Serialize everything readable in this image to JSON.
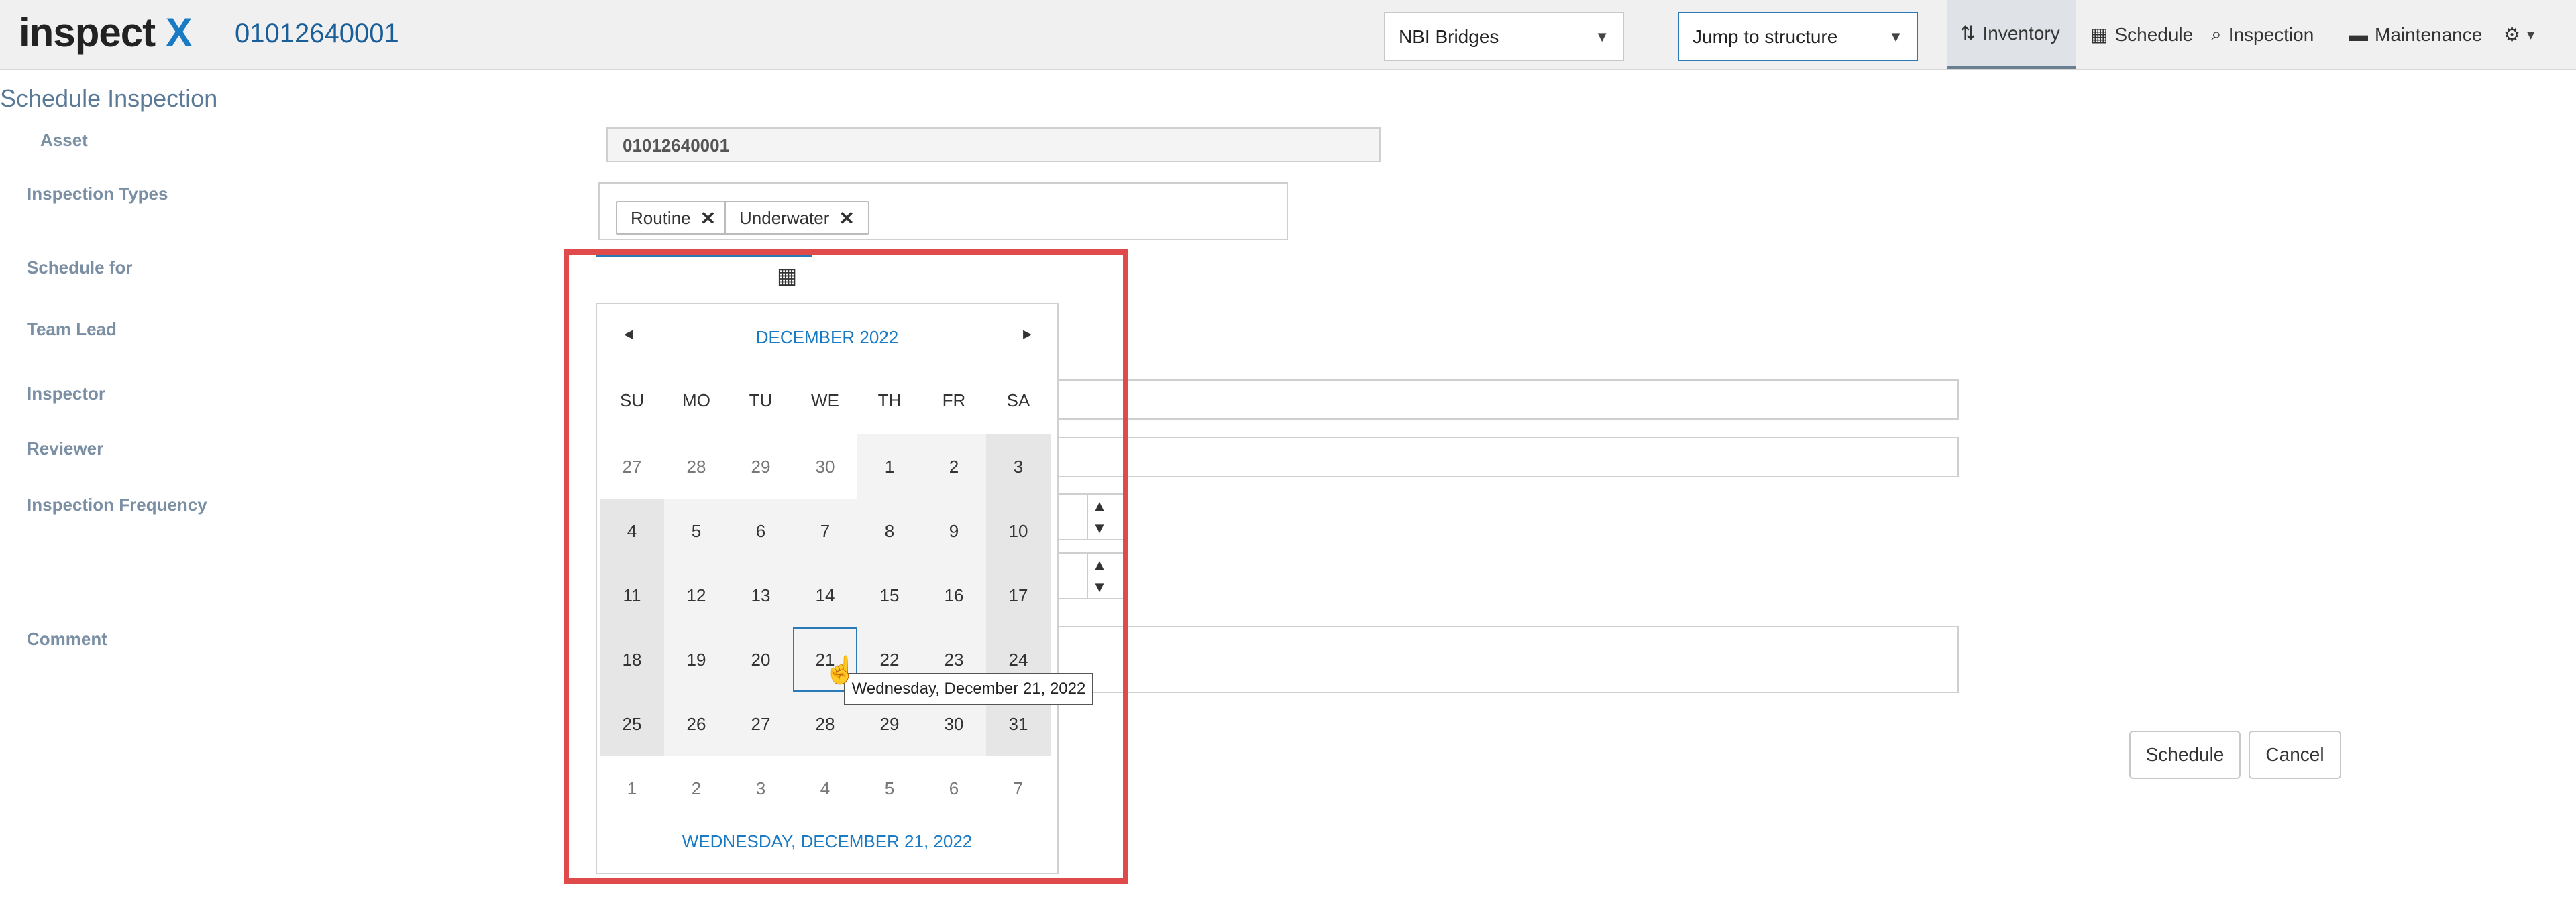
{
  "app": {
    "logo_text": "inspect",
    "logo_x": "X",
    "asset_id": "01012640001"
  },
  "header": {
    "bridge_select": "NBI Bridges",
    "jump_select": "Jump to structure",
    "nav": [
      {
        "label": "Inventory",
        "icon": "sort-icon"
      },
      {
        "label": "Schedule",
        "icon": "calendar-icon"
      },
      {
        "label": "Inspection",
        "icon": "search-icon"
      },
      {
        "label": "Maintenance",
        "icon": "briefcase-icon"
      },
      {
        "label": "",
        "icon": "gear-icon"
      }
    ]
  },
  "form": {
    "title": "Schedule Inspection",
    "labels": {
      "asset": "Asset",
      "types": "Inspection Types",
      "schedule_for": "Schedule for",
      "team_lead": "Team Lead",
      "inspector": "Inspector",
      "reviewer": "Reviewer",
      "frequency": "Inspection Frequency",
      "comment": "Comment"
    },
    "asset_value": "01012640001",
    "types": [
      "Routine",
      "Underwater"
    ],
    "schedule_label": "Schedule",
    "cancel_label": "Cancel"
  },
  "calendar": {
    "month_title": "DECEMBER 2022",
    "days_of_week": [
      "SU",
      "MO",
      "TU",
      "WE",
      "TH",
      "FR",
      "SA"
    ],
    "weeks": [
      [
        "27",
        "28",
        "29",
        "30",
        "1",
        "2",
        "3"
      ],
      [
        "4",
        "5",
        "6",
        "7",
        "8",
        "9",
        "10"
      ],
      [
        "11",
        "12",
        "13",
        "14",
        "15",
        "16",
        "17"
      ],
      [
        "18",
        "19",
        "20",
        "21",
        "22",
        "23",
        "24"
      ],
      [
        "25",
        "26",
        "27",
        "28",
        "29",
        "30",
        "31"
      ],
      [
        "1",
        "2",
        "3",
        "4",
        "5",
        "6",
        "7"
      ]
    ],
    "selected_day": "21",
    "footer": "WEDNESDAY, DECEMBER 21, 2022",
    "tooltip": "Wednesday, December 21, 2022"
  }
}
